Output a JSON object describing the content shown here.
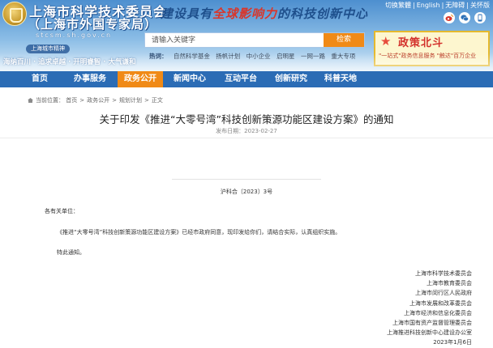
{
  "header": {
    "org_name": "上海市科学技术委员会",
    "org_sub": "（上海市外国专家局）",
    "org_url": "stcsm.sh.gov.cn",
    "spirit_badge": "上海城市精神",
    "spirit_text": "海纳百川 · 追求卓越 · 开明睿智 · 大气谦和",
    "slogan_a": "建设具有",
    "slogan_b": "全球影响力",
    "slogan_c": "的科技创新中心",
    "top_links": [
      "切换繁體",
      "English",
      "无障碍",
      "关怀版"
    ],
    "social_icons": [
      "weibo-icon",
      "wechat-icon",
      "mobile-icon"
    ],
    "search": {
      "placeholder": "请输入关键字",
      "button": "检索"
    },
    "hot_label": "热词：",
    "hot_words": [
      "自然科学基金",
      "扬帆计划",
      "中小企业",
      "启明星",
      "一网一路",
      "重大专项"
    ],
    "banner": {
      "title": "政策北斗",
      "subtitle": "\"一站式\"政务信息服务 \"触达\"百万企业"
    }
  },
  "nav": {
    "items": [
      "首页",
      "办事服务",
      "政务公开",
      "新闻中心",
      "互动平台",
      "创新研究",
      "科普天地"
    ],
    "active_index": 2
  },
  "breadcrumb": {
    "label": "当前位置：",
    "items": [
      "首页",
      "政务公开",
      "规划计划",
      "正文"
    ]
  },
  "article": {
    "title": "关于印发《推进“大零号湾”科技创新策源功能区建设方案》的通知",
    "pub_date": "发布日期：2023-02-27",
    "doc_no": "沪科合〔2023〕3号",
    "recipient": "各有关单位：",
    "body": "《推进“大零号湾”科技创新策源功能区建设方案》已经市政府同意，现印发给你们，请结合实际，认真组织实施。",
    "closing": "特此通知。",
    "signers": [
      "上海市科学技术委员会",
      "上海市教育委员会",
      "上海市闵行区人民政府",
      "上海市发展和改革委员会",
      "上海市经济和信息化委员会",
      "上海市国有资产监督管理委员会",
      "上海推进科技创新中心建设办公室",
      "2023年1月6日"
    ]
  },
  "colors": {
    "nav_bg": "#2b6cb5",
    "nav_active": "#f08a17",
    "search_button": "#f08a17",
    "banner_title": "#d3302b"
  }
}
